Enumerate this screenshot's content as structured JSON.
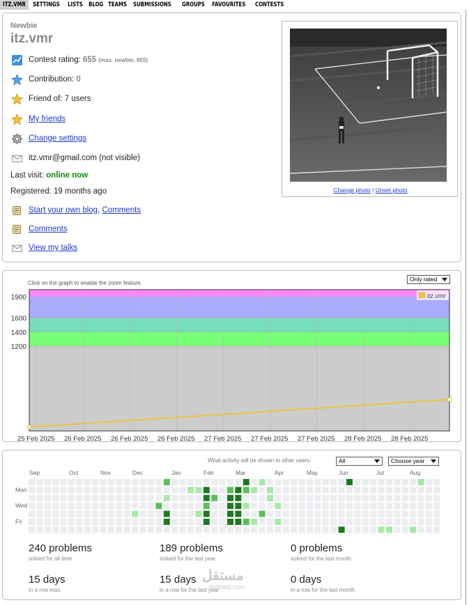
{
  "nav": {
    "items": [
      "ITZ.VMR",
      "SETTINGS",
      "LISTS",
      "BLOG",
      "TEAMS",
      "SUBMISSIONS",
      "GROUPS",
      "FAVOURITES",
      "CONTESTS"
    ]
  },
  "profile": {
    "rank": "Newbie",
    "handle": "itz.vmr",
    "contest_rating_label": "Contest rating:",
    "contest_rating_value": "655",
    "contest_rating_max": "(max. newbie, 655)",
    "contribution_label": "Contribution:",
    "contribution_value": "0",
    "friend_of": "Friend of: 7 users",
    "my_friends": "My friends",
    "change_settings": "Change settings",
    "email": "itz.vmr@gmail.com (not visible)",
    "last_visit_label": "Last visit:",
    "last_visit_value": "online now",
    "registered": "Registered: 19 months ago",
    "blog_link": "Start your own blog",
    "blog_comma": ",",
    "comments_link_inline": "Comments",
    "comments_link": "Comments",
    "talks_link": "View my talks",
    "change_photo": "Change photo",
    "photo_sep": "|",
    "unset_photo": "Unset photo"
  },
  "rating_graph": {
    "hint": "Click on the graph to enable the zoom feature.",
    "filter_selected": "Only rated",
    "legend_name": "itz.vmr",
    "colors": {
      "series": "#edc240",
      "gray": "#cccccc",
      "green": "#77ff77",
      "cyan": "#77ddbb",
      "blue": "#aaaaff",
      "violet": "#ff88ff"
    }
  },
  "chart_data": {
    "type": "line",
    "title": "",
    "xlabel": "",
    "ylabel": "",
    "y_ticks": [
      1200,
      1400,
      1600,
      1900
    ],
    "x_ticks": [
      "25 Feb 2025",
      "26 Feb 2025",
      "26 Feb 2025",
      "26 Feb 2025",
      "27 Feb 2025",
      "27 Feb 2025",
      "27 Feb 2025",
      "28 Feb 2025",
      "28 Feb 2025"
    ],
    "series": [
      {
        "name": "itz.vmr",
        "points": [
          {
            "x": 0,
            "y": 55
          },
          {
            "x": 1,
            "y": 445
          }
        ]
      }
    ],
    "bands": [
      {
        "from": 0,
        "to": 1200,
        "color": "#cccccc"
      },
      {
        "from": 1200,
        "to": 1400,
        "color": "#77ff77"
      },
      {
        "from": 1400,
        "to": 1600,
        "color": "#77ddbb"
      },
      {
        "from": 1600,
        "to": 1900,
        "color": "#aaaaff"
      },
      {
        "from": 1900,
        "to": 2000,
        "color": "#ff88ff"
      }
    ],
    "ylim": [
      0,
      2000
    ],
    "grid": true,
    "legend_position": "top-right"
  },
  "activity": {
    "label": "What activity will be shown to other users:",
    "shown_selected": "All",
    "year_selected": "Choose year",
    "months": [
      "Sep",
      "Oct",
      "Nov",
      "Dec",
      "Jan",
      "Feb",
      "Mar",
      "Apr",
      "May",
      "Jun",
      "Jul",
      "Aug"
    ],
    "days": [
      "Mon",
      "Wed",
      "Fri"
    ],
    "stats": [
      {
        "big": "240 problems",
        "sub": "solved for all time"
      },
      {
        "big": "189 problems",
        "sub": "solved for the last year"
      },
      {
        "big": "0 problems",
        "sub": "solved for the last month"
      },
      {
        "big": "15 days",
        "sub": "in a row max."
      },
      {
        "big": "15 days",
        "sub": "in a row for the last year"
      },
      {
        "big": "0 days",
        "sub": "in a row for the last month"
      }
    ],
    "colors": {
      "empty": "#ebedf0",
      "light": "#a6e8a6",
      "mid": "#59c059",
      "dark": "#1e7a1e"
    }
  },
  "watermark": {
    "text": "مستقل",
    "sub": "mostaql.com"
  }
}
